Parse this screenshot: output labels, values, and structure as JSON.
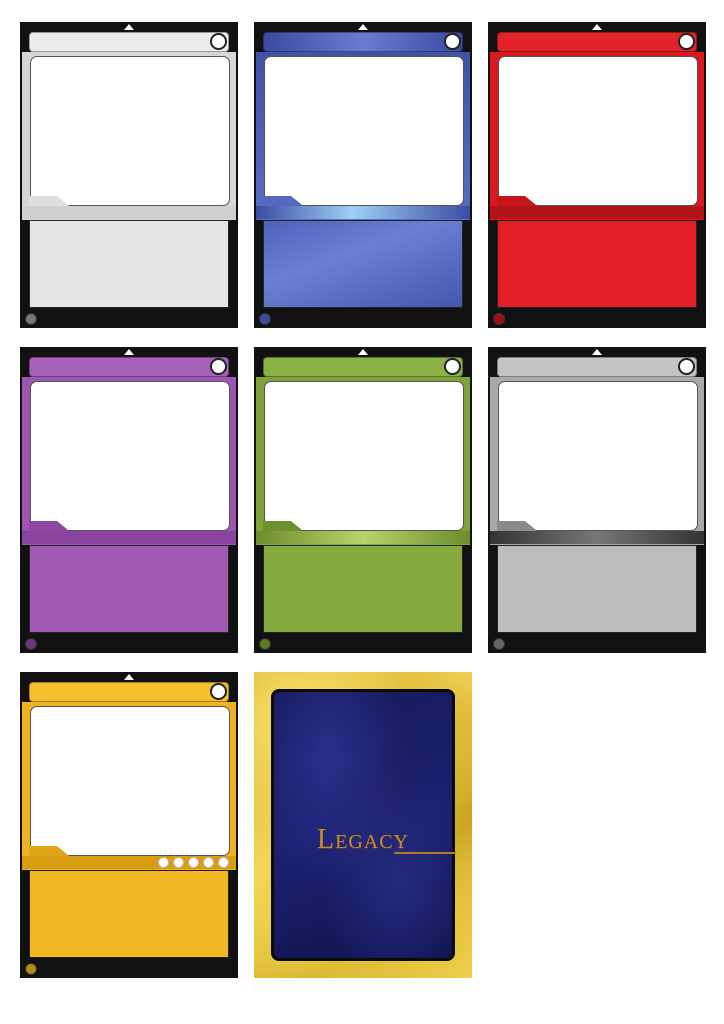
{
  "cards": [
    {
      "id": "white",
      "colors": {
        "frame": "#e7e7e7",
        "dark": "#bdbdbd"
      }
    },
    {
      "id": "blue",
      "colors": {
        "frame": "#4f5fb5",
        "dark": "#2f3b8f"
      }
    },
    {
      "id": "red",
      "colors": {
        "frame": "#e41e26",
        "dark": "#a3151a"
      }
    },
    {
      "id": "purple",
      "colors": {
        "frame": "#a25bb4",
        "dark": "#7a3d8b"
      }
    },
    {
      "id": "green",
      "colors": {
        "frame": "#86aa3e",
        "dark": "#5f7e27"
      }
    },
    {
      "id": "gray",
      "colors": {
        "frame": "#bdbdbd",
        "dark": "#4a4a4a"
      }
    },
    {
      "id": "gold",
      "colors": {
        "frame": "#f2b824",
        "dark": "#d39a12"
      },
      "gems": 5
    }
  ],
  "card_back": {
    "logo_text": "Legacy",
    "colors": {
      "border": "#e2c146",
      "field": "#1b2070",
      "logo": "#c98a2e"
    }
  }
}
